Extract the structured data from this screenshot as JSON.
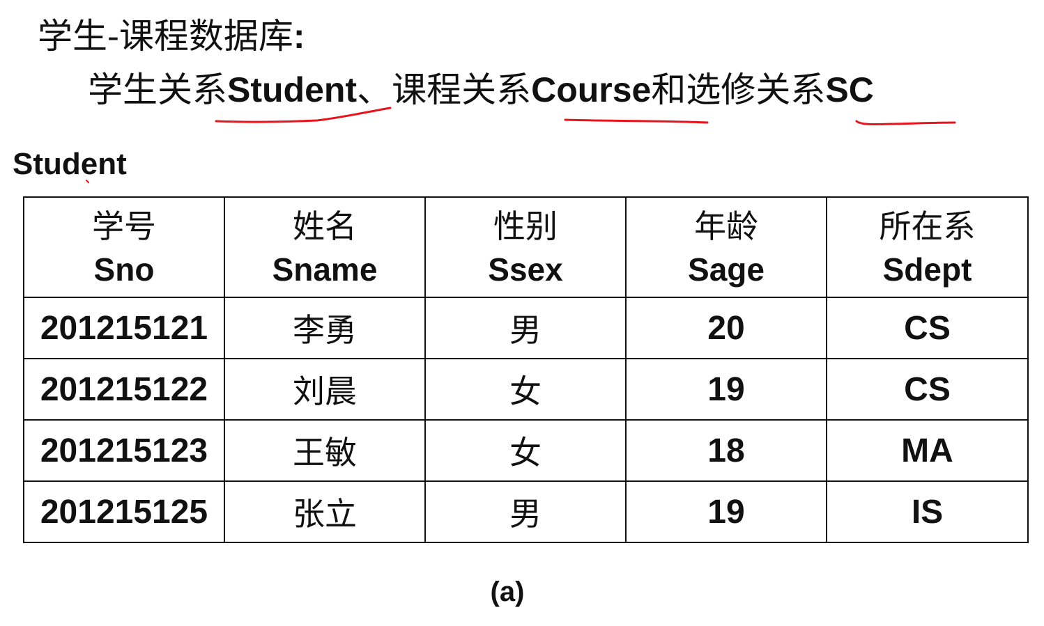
{
  "heading": {
    "text": "学生-课程数据库",
    "colon": ":"
  },
  "subheading": {
    "part1": "学生关系",
    "student": "Student",
    "sep": "、",
    "part2": "课程关系",
    "course": "Course",
    "part3": "和选修关系",
    "sc": "SC"
  },
  "annotation_color": "#e8141c",
  "table_title": "Student",
  "table": {
    "columns": [
      {
        "cn": "学号",
        "en": "Sno"
      },
      {
        "cn": "姓名",
        "en": "Sname"
      },
      {
        "cn": "性别",
        "en": "Ssex"
      },
      {
        "cn": "年龄",
        "en": "Sage"
      },
      {
        "cn": "所在系",
        "en": "Sdept"
      }
    ],
    "rows": [
      [
        "201215121",
        "李勇",
        "男",
        "20",
        "CS"
      ],
      [
        "201215122",
        "刘晨",
        "女",
        "19",
        "CS"
      ],
      [
        "201215123",
        "王敏",
        "女",
        "18",
        "MA"
      ],
      [
        "201215125",
        "张立",
        "男",
        "19",
        "IS"
      ]
    ]
  },
  "caption": "(a)"
}
